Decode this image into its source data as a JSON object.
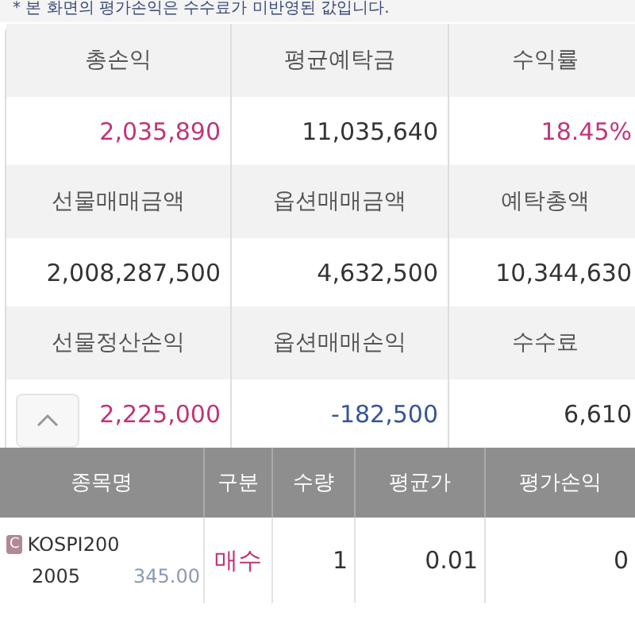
{
  "notice": "* 본 화면의 평가손익은 수수료가 미반영된 값입니다.",
  "summary": [
    {
      "labels": [
        "총손익",
        "평균예탁금",
        "수익률"
      ],
      "values": [
        {
          "text": "2,035,890",
          "color": "#c0357a"
        },
        {
          "text": "11,035,640",
          "color": "#333333"
        },
        {
          "text": "18.45%",
          "color": "#c0357a"
        }
      ]
    },
    {
      "labels": [
        "선물매매금액",
        "옵션매매금액",
        "예탁총액"
      ],
      "values": [
        {
          "text": "2,008,287,500",
          "color": "#333333"
        },
        {
          "text": "4,632,500",
          "color": "#333333"
        },
        {
          "text": "10,344,630",
          "color": "#333333"
        }
      ]
    },
    {
      "labels": [
        "선물정산손익",
        "옵션매매손익",
        "수수료"
      ],
      "values": [
        {
          "text": "2,225,000",
          "color": "#c0357a"
        },
        {
          "text": "-182,500",
          "color": "#34559a"
        },
        {
          "text": "6,610",
          "color": "#333333"
        }
      ]
    }
  ],
  "positions": {
    "columns": [
      "종목명",
      "구분",
      "수량",
      "평균가",
      "평가손익"
    ],
    "rows": [
      {
        "badge": "C",
        "name": "KOSPI200",
        "code": "2005",
        "strike": "345.00",
        "side": {
          "text": "매수",
          "color": "#c0357a"
        },
        "quantity": "1",
        "average_price": "0.01",
        "eval_pl": "0"
      }
    ]
  }
}
